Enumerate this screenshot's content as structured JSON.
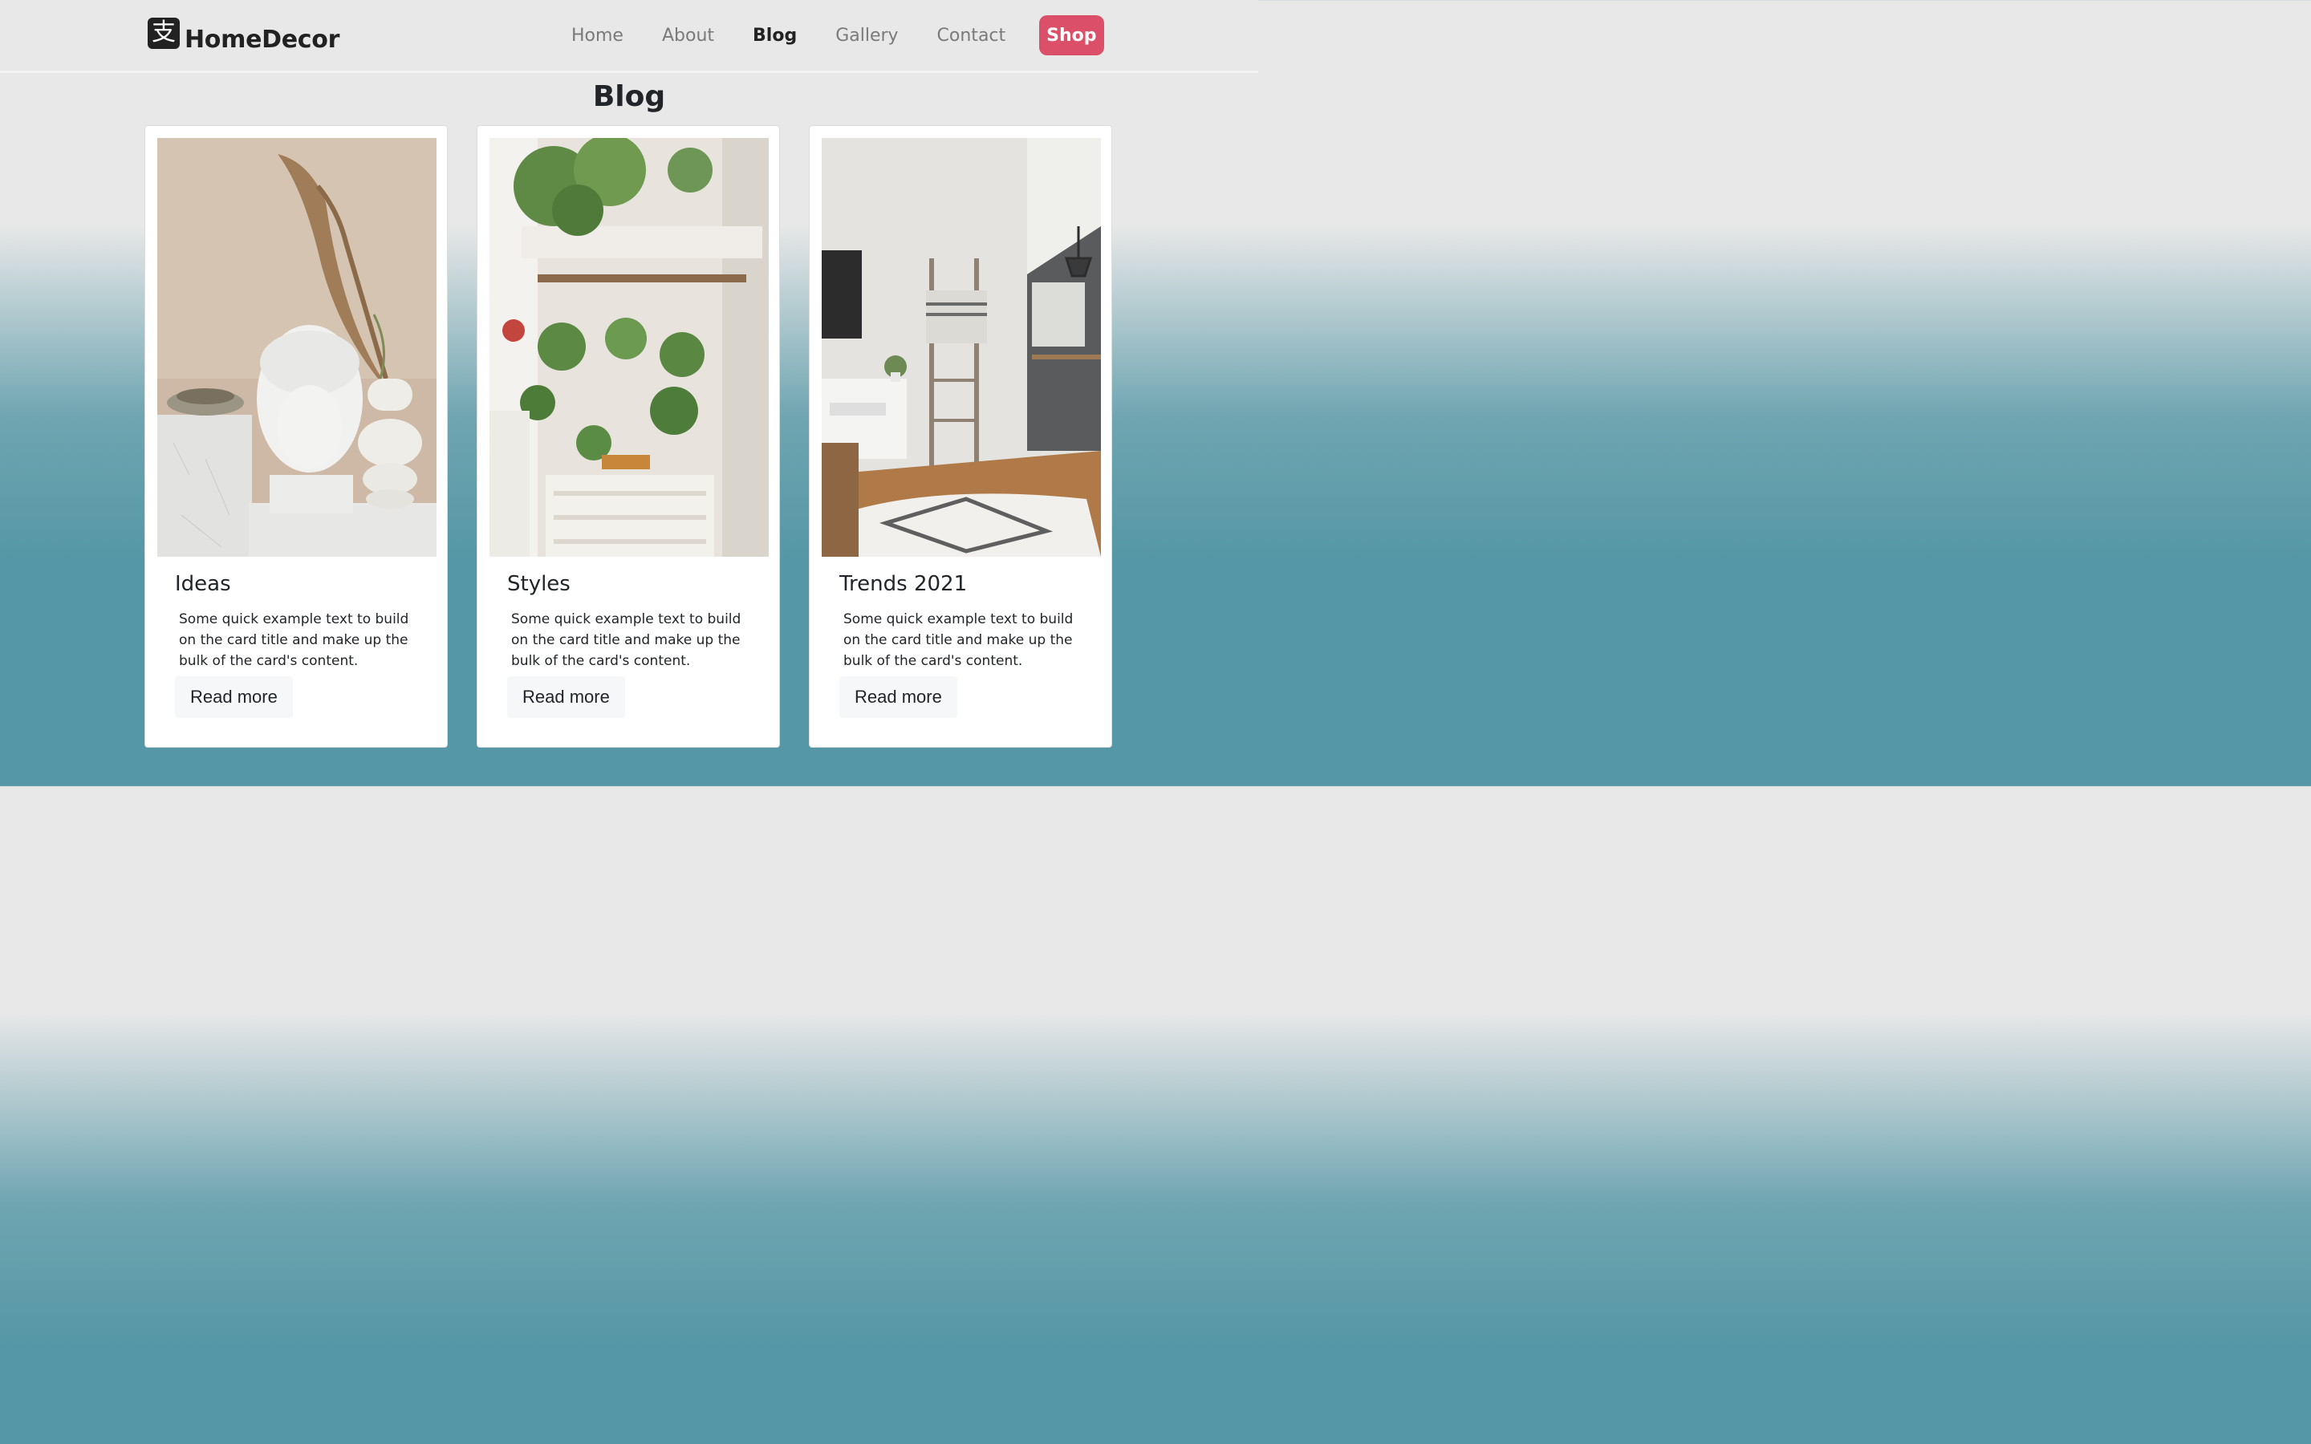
{
  "brand": {
    "name": "HomeDecor",
    "icon": "brand-logo-icon",
    "icon_glyph": "支"
  },
  "nav": {
    "items": [
      {
        "label": "Home",
        "active": false
      },
      {
        "label": "About",
        "active": false
      },
      {
        "label": "Blog",
        "active": true
      },
      {
        "label": "Gallery",
        "active": false
      },
      {
        "label": "Contact",
        "active": false
      }
    ],
    "shop_label": "Shop"
  },
  "page": {
    "title": "Blog"
  },
  "cards": [
    {
      "title": "Ideas",
      "text": "Some quick example text to build on the card title and make up the bulk of the card's content.",
      "button": "Read more",
      "image": "buddha-head-pampas-vase-photo"
    },
    {
      "title": "Styles",
      "text": "Some quick example text to build on the card title and make up the bulk of the card's content.",
      "button": "Read more",
      "image": "hanging-plants-room-photo"
    },
    {
      "title": "Trends 2021",
      "text": "Some quick example text to build on the card title and make up the bulk of the card's content.",
      "button": "Read more",
      "image": "living-room-ladder-photo"
    }
  ],
  "colors": {
    "shop": "#db5068",
    "gradient_bottom": "#5597a6",
    "nav_bg": "#e8e8e8"
  }
}
